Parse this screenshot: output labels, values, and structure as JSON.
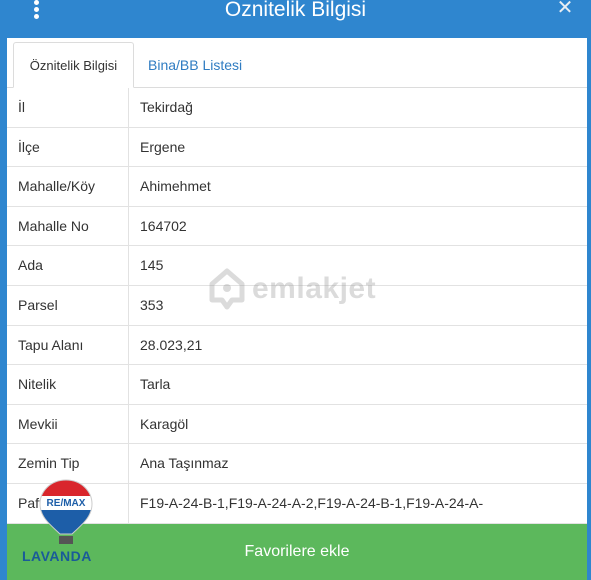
{
  "header": {
    "title": "Öznitelik Bilgisi",
    "menu_icon": "kebab-menu-icon",
    "close_icon": "close-icon"
  },
  "tabs": [
    {
      "label": "Öznitelik Bilgisi",
      "active": true
    },
    {
      "label": "Bina/BB Listesi",
      "active": false
    }
  ],
  "rows": [
    {
      "key": "İl",
      "value": "Tekirdağ"
    },
    {
      "key": "İlçe",
      "value": "Ergene"
    },
    {
      "key": "Mahalle/Köy",
      "value": "Ahimehmet"
    },
    {
      "key": "Mahalle No",
      "value": "164702"
    },
    {
      "key": "Ada",
      "value": "145"
    },
    {
      "key": "Parsel",
      "value": "353"
    },
    {
      "key": "Tapu Alanı",
      "value": "28.023,21"
    },
    {
      "key": "Nitelik",
      "value": "Tarla"
    },
    {
      "key": "Mevkii",
      "value": "Karagöl"
    },
    {
      "key": "Zemin Tip",
      "value": "Ana Taşınmaz"
    },
    {
      "key": "Pafta",
      "value": "F19-A-24-B-1,F19-A-24-A-2,F19-A-24-B-1,F19-A-24-A-"
    }
  ],
  "watermark": {
    "text": "emlakjet"
  },
  "footer": {
    "button_label": "Favorilere ekle"
  },
  "logo": {
    "brand": "RE/MAX",
    "office": "LAVANDA"
  },
  "colors": {
    "header": "#2f86cf",
    "footer": "#5cb85c",
    "tab_link": "#2f7cc2"
  }
}
